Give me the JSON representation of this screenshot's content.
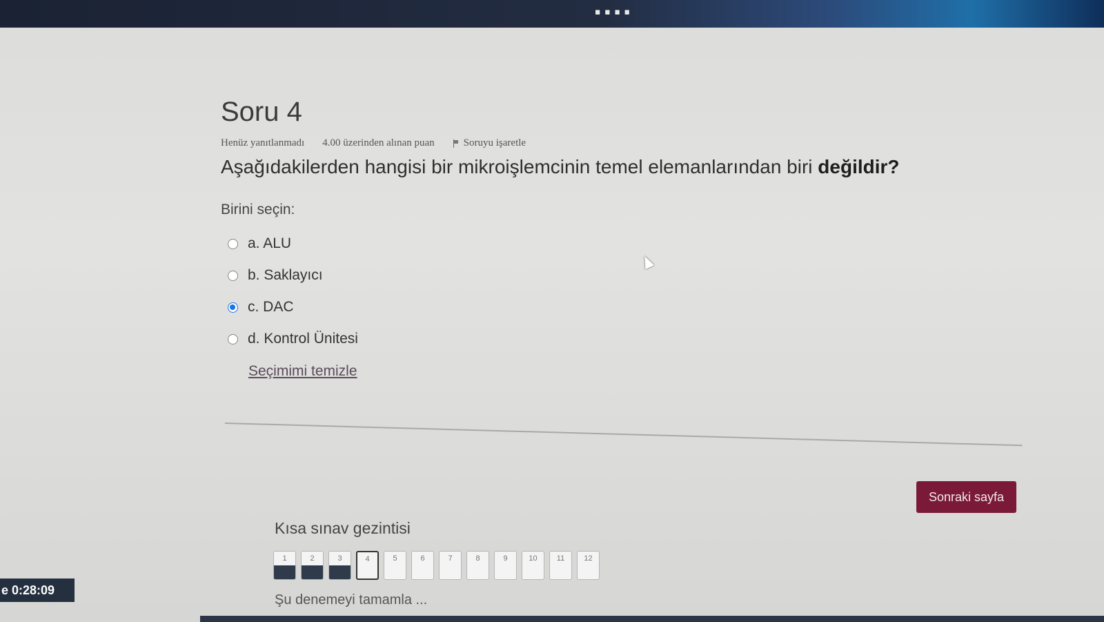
{
  "banner": {
    "text": "...."
  },
  "question": {
    "title": "Soru 4",
    "status": "Henüz yanıtlanmadı",
    "points": "4.00 üzerinden alınan puan",
    "flag_label": "Soruyu işaretle",
    "text_main": "Aşağıdakilerden hangisi bir mikroişlemcinin temel elemanlarından biri ",
    "text_bold": "değildir?",
    "prompt": "Birini seçin:",
    "answers": [
      {
        "label": "a. ALU",
        "selected": false
      },
      {
        "label": "b. Saklayıcı",
        "selected": false
      },
      {
        "label": "c. DAC",
        "selected": true
      },
      {
        "label": "d. Kontrol Ünitesi",
        "selected": false
      }
    ],
    "clear_label": "Seçimimi temizle"
  },
  "next_button_label": "Sonraki sayfa",
  "quiz_nav": {
    "title": "Kısa sınav gezintisi",
    "items": [
      "1",
      "2",
      "3",
      "4",
      "5",
      "6",
      "7",
      "8",
      "9",
      "10",
      "11",
      "12"
    ],
    "answered": [
      1,
      2,
      3
    ],
    "current": 4,
    "finish_label": "Şu denemeyi tamamla ..."
  },
  "timer": {
    "text": "e 0:28:09"
  },
  "colors": {
    "accent": "#7a1a38",
    "radio": "#1a73e8",
    "nav_fill": "#2f3a4a"
  }
}
